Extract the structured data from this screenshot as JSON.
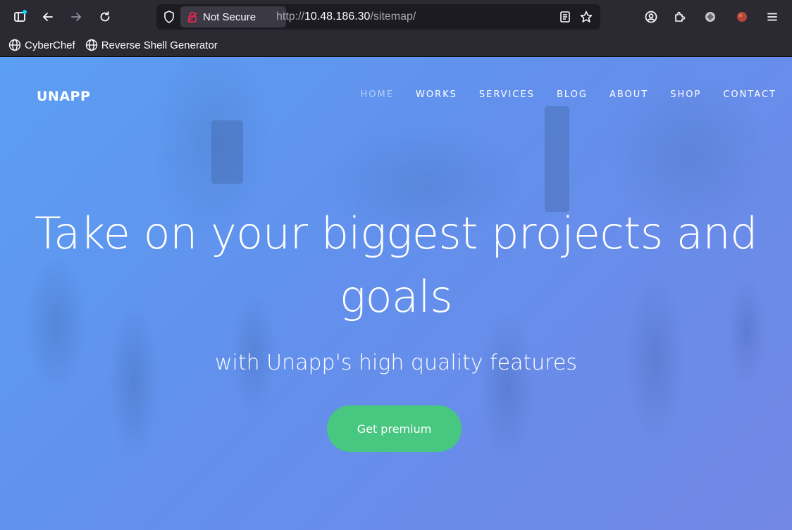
{
  "browser": {
    "security_label": "Not Secure",
    "url_prefix": "http://",
    "url_host": "10.48.186.30",
    "url_path": "/sitemap/",
    "bookmarks": [
      {
        "label": "CyberChef",
        "icon": "globe-icon"
      },
      {
        "label": "Reverse Shell Generator",
        "icon": "globe-icon"
      }
    ]
  },
  "site": {
    "brand": "UNAPP",
    "nav": [
      {
        "label": "HOME",
        "active": true
      },
      {
        "label": "WORKS",
        "active": false
      },
      {
        "label": "SERVICES",
        "active": false
      },
      {
        "label": "BLOG",
        "active": false
      },
      {
        "label": "ABOUT",
        "active": false
      },
      {
        "label": "SHOP",
        "active": false
      },
      {
        "label": "CONTACT",
        "active": false
      }
    ],
    "hero": {
      "title_line1": "Take on your biggest projects and",
      "title_line2": "goals",
      "subtitle": "with Unapp's high quality features",
      "cta_label": "Get premium"
    }
  },
  "colors": {
    "chrome": "#2b2a33",
    "url_field": "#1c1b22",
    "hero_gradient_start": "#5b9ef2",
    "hero_gradient_end": "#7387e6",
    "cta": "#47c77f",
    "insecure_lock": "#e22850"
  }
}
